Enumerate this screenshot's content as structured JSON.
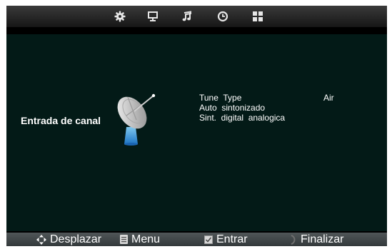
{
  "top_tabs": [
    {
      "icon": "gear-icon"
    },
    {
      "icon": "monitor-icon"
    },
    {
      "icon": "music-note-icon"
    },
    {
      "icon": "clock-icon"
    },
    {
      "icon": "grid-icon"
    }
  ],
  "channel": {
    "title": "Entrada de canal",
    "illustration": "satellite-dish-icon"
  },
  "menu_items": [
    {
      "label": "Tune  Type",
      "value": "Air"
    },
    {
      "label": "Auto  sintonizado"
    },
    {
      "label": "Sint.  digital  analogica"
    }
  ],
  "footer": {
    "navigate": "Desplazar",
    "menu": "Menu",
    "enter": "Entrar",
    "exit": "Finalizar"
  },
  "colors": {
    "panel": "#031a17",
    "footer": "#3b4143",
    "text": "#ffffff"
  }
}
